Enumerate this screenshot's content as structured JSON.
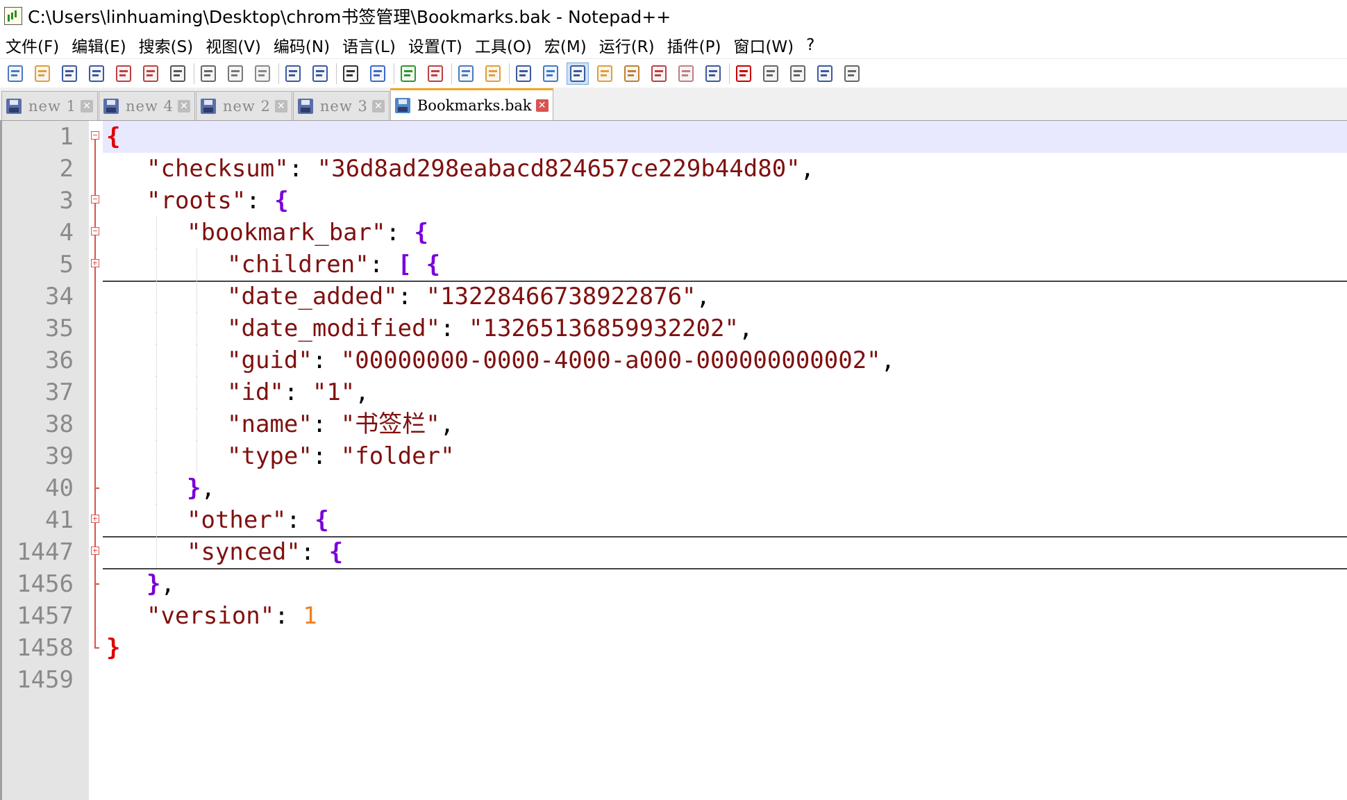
{
  "window": {
    "title": "C:\\Users\\linhuaming\\Desktop\\chrom书签管理\\Bookmarks.bak - Notepad++"
  },
  "menu": [
    "文件(F)",
    "编辑(E)",
    "搜索(S)",
    "视图(V)",
    "编码(N)",
    "语言(L)",
    "设置(T)",
    "工具(O)",
    "宏(M)",
    "运行(R)",
    "插件(P)",
    "窗口(W)",
    "?"
  ],
  "toolbar": {
    "icons": [
      "new-file-icon",
      "open-file-icon",
      "save-icon",
      "save-all-icon",
      "close-icon",
      "close-all-icon",
      "print-icon",
      "cut-icon",
      "copy-icon",
      "paste-icon",
      "undo-icon",
      "redo-icon",
      "find-icon",
      "replace-icon",
      "zoom-in-icon",
      "zoom-out-icon",
      "sync-vertical-icon",
      "sync-horizontal-icon",
      "word-wrap-icon",
      "show-all-characters-icon",
      "indent-guide-icon",
      "user-defined-language-icon",
      "document-map-icon",
      "function-list-icon",
      "folder-as-workspace-icon",
      "monitoring-icon",
      "record-macro-icon",
      "stop-record-icon",
      "playback-macro-icon",
      "run-macro-multiple-icon",
      "save-macro-icon"
    ]
  },
  "tabs": [
    {
      "label": "new  1",
      "active": false
    },
    {
      "label": "new  4",
      "active": false
    },
    {
      "label": "new  2",
      "active": false
    },
    {
      "label": "new  3",
      "active": false
    },
    {
      "label": "Bookmarks.bak",
      "active": true
    }
  ],
  "editor": {
    "lines": [
      {
        "n": "1",
        "indent": 0,
        "tokens": [
          [
            "br-root",
            "{"
          ]
        ],
        "fold": "open",
        "current": true
      },
      {
        "n": "2",
        "indent": 1,
        "tokens": [
          [
            "s",
            "\"checksum\""
          ],
          [
            "op",
            ": "
          ],
          [
            "s",
            "\"36d8ad298eabacd824657ce229b44d80\""
          ],
          [
            "op",
            ","
          ]
        ],
        "fold": "line"
      },
      {
        "n": "3",
        "indent": 1,
        "tokens": [
          [
            "s",
            "\"roots\""
          ],
          [
            "op",
            ": "
          ],
          [
            "br",
            "{"
          ]
        ],
        "fold": "open"
      },
      {
        "n": "4",
        "indent": 2,
        "tokens": [
          [
            "s",
            "\"bookmark_bar\""
          ],
          [
            "op",
            ": "
          ],
          [
            "br",
            "{"
          ]
        ],
        "fold": "open"
      },
      {
        "n": "5",
        "indent": 3,
        "tokens": [
          [
            "s",
            "\"children\""
          ],
          [
            "op",
            ": "
          ],
          [
            "br",
            "[ {"
          ]
        ],
        "fold": "collapsed",
        "folded_below": true
      },
      {
        "n": "34",
        "indent": 3,
        "tokens": [
          [
            "s",
            "\"date_added\""
          ],
          [
            "op",
            ": "
          ],
          [
            "s",
            "\"13228466738922876\""
          ],
          [
            "op",
            ","
          ]
        ],
        "fold": "line"
      },
      {
        "n": "35",
        "indent": 3,
        "tokens": [
          [
            "s",
            "\"date_modified\""
          ],
          [
            "op",
            ": "
          ],
          [
            "s",
            "\"13265136859932202\""
          ],
          [
            "op",
            ","
          ]
        ],
        "fold": "line"
      },
      {
        "n": "36",
        "indent": 3,
        "tokens": [
          [
            "s",
            "\"guid\""
          ],
          [
            "op",
            ": "
          ],
          [
            "s",
            "\"00000000-0000-4000-a000-000000000002\""
          ],
          [
            "op",
            ","
          ]
        ],
        "fold": "line"
      },
      {
        "n": "37",
        "indent": 3,
        "tokens": [
          [
            "s",
            "\"id\""
          ],
          [
            "op",
            ": "
          ],
          [
            "s",
            "\"1\""
          ],
          [
            "op",
            ","
          ]
        ],
        "fold": "line"
      },
      {
        "n": "38",
        "indent": 3,
        "tokens": [
          [
            "s",
            "\"name\""
          ],
          [
            "op",
            ": "
          ],
          [
            "s",
            "\"书签栏\""
          ],
          [
            "op",
            ","
          ]
        ],
        "fold": "line"
      },
      {
        "n": "39",
        "indent": 3,
        "tokens": [
          [
            "s",
            "\"type\""
          ],
          [
            "op",
            ": "
          ],
          [
            "s",
            "\"folder\""
          ]
        ],
        "fold": "line"
      },
      {
        "n": "40",
        "indent": 2,
        "tokens": [
          [
            "br",
            "}"
          ],
          [
            "op",
            ","
          ]
        ],
        "fold": "end"
      },
      {
        "n": "41",
        "indent": 2,
        "tokens": [
          [
            "s",
            "\"other\""
          ],
          [
            "op",
            ": "
          ],
          [
            "br",
            "{"
          ]
        ],
        "fold": "collapsed",
        "folded_below": true
      },
      {
        "n": "1447",
        "indent": 2,
        "tokens": [
          [
            "s",
            "\"synced\""
          ],
          [
            "op",
            ": "
          ],
          [
            "br",
            "{"
          ]
        ],
        "fold": "collapsed",
        "folded_below": true
      },
      {
        "n": "1456",
        "indent": 1,
        "tokens": [
          [
            "br",
            "}"
          ],
          [
            "op",
            ","
          ]
        ],
        "fold": "end"
      },
      {
        "n": "1457",
        "indent": 1,
        "tokens": [
          [
            "s",
            "\"version\""
          ],
          [
            "op",
            ": "
          ],
          [
            "num",
            "1"
          ]
        ],
        "fold": "line"
      },
      {
        "n": "1458",
        "indent": 0,
        "tokens": [
          [
            "br-root",
            "}"
          ]
        ],
        "fold": "end"
      },
      {
        "n": "1459",
        "indent": 0,
        "tokens": [],
        "fold": "none"
      }
    ]
  }
}
